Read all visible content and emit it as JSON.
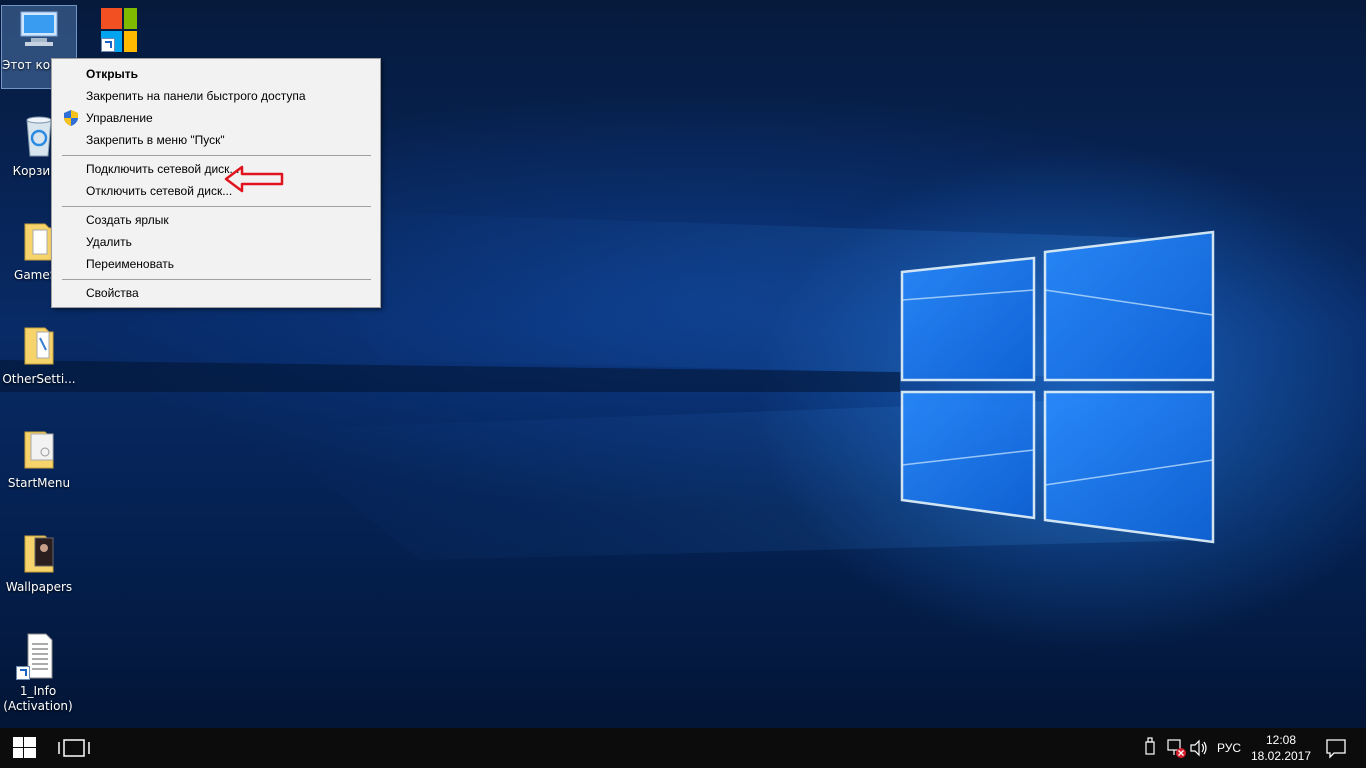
{
  "desktop": {
    "icons": [
      {
        "label": "Этот компьютер",
        "type": "computer"
      },
      {
        "label": "",
        "type": "store-shortcut"
      },
      {
        "label": "Корзина",
        "type": "recycle-bin"
      },
      {
        "label": "GameSc",
        "type": "folder"
      },
      {
        "label": "OtherSetti...",
        "type": "folder"
      },
      {
        "label": "StartMenu",
        "type": "folder"
      },
      {
        "label": "Wallpapers",
        "type": "folder"
      },
      {
        "label": "1_Info (Activation)",
        "type": "document-shortcut"
      }
    ]
  },
  "context_menu": {
    "items": [
      {
        "label": "Открыть",
        "bold": true
      },
      {
        "label": "Закрепить на панели быстрого доступа"
      },
      {
        "label": "Управление",
        "icon": "uac-shield-icon"
      },
      {
        "label": "Закрепить в меню \"Пуск\""
      },
      {
        "label": "Подключить сетевой диск..."
      },
      {
        "label": "Отключить сетевой диск..."
      },
      {
        "label": "Создать ярлык"
      },
      {
        "label": "Удалить"
      },
      {
        "label": "Переименовать"
      },
      {
        "label": "Свойства"
      }
    ],
    "annotation_color": "#e0141e"
  },
  "taskbar": {
    "language": "РУС",
    "time": "12:08",
    "date": "18.02.2017",
    "tray_icons": [
      "usb-icon",
      "network-disconnected-icon",
      "volume-icon"
    ]
  },
  "colors": {
    "taskbar_bg": "#0c0c0c",
    "menu_bg": "#f2f2f2",
    "accent": "#1a78ff"
  }
}
